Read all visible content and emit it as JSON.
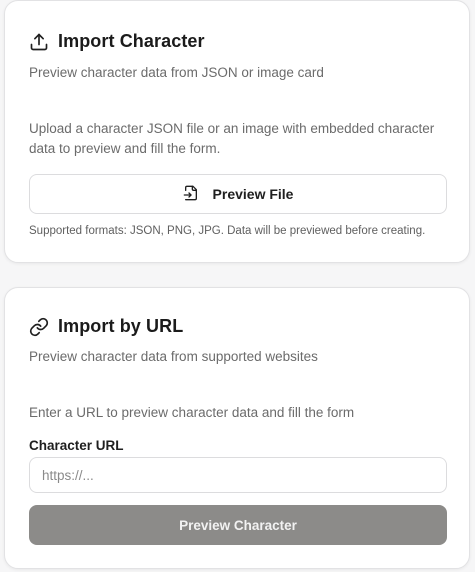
{
  "import_character": {
    "title": "Import Character",
    "subtitle": "Preview character data from JSON or image card",
    "description": "Upload a character JSON file or an image with embedded character data to preview and fill the form.",
    "preview_button_label": "Preview File",
    "note": "Supported formats: JSON, PNG, JPG. Data will be previewed before creating.",
    "icon": "upload-icon",
    "button_icon": "file-import-icon"
  },
  "import_url": {
    "title": "Import by URL",
    "subtitle": "Preview character data from supported websites",
    "description": "Enter a URL to preview character data and fill the form",
    "field_label": "Character URL",
    "field_placeholder": "https://...",
    "field_value": "",
    "preview_button_label": "Preview Character",
    "icon": "link-icon"
  },
  "colors": {
    "background": "#f6f6f7",
    "card": "#ffffff",
    "disabled_button": "#8c8b89",
    "muted_text": "#6b6b6b"
  }
}
